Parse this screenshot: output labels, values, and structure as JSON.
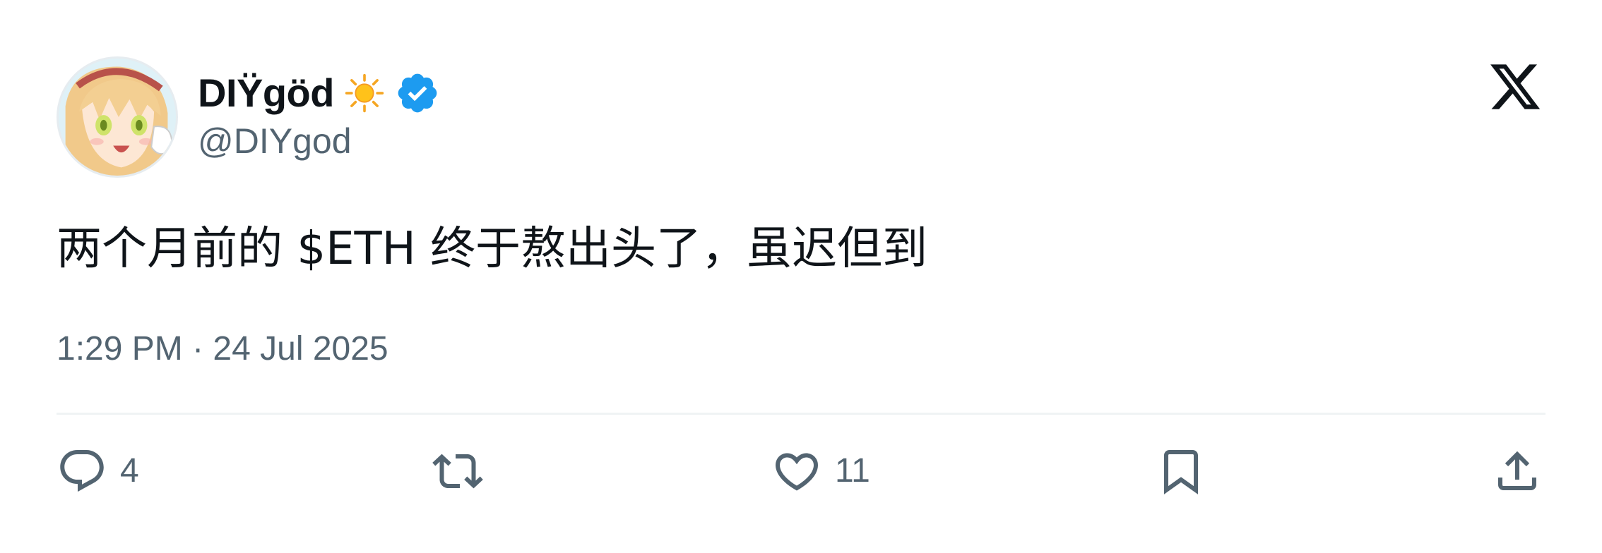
{
  "author": {
    "display_name": "DIŸgöd",
    "handle": "@DIYgod",
    "name_emoji": "sun-icon",
    "verified_icon": "verified-badge-icon",
    "verified_color": "#1d9bf0"
  },
  "tweet": {
    "text_before_cashtag": "两个月前的 ",
    "cashtag": "$ETH",
    "text_after_cashtag": " 终于熬出头了，虽迟但到",
    "timestamp": "1:29 PM · 24 Jul 2025"
  },
  "actions": {
    "reply": {
      "icon": "reply-icon",
      "count": "4"
    },
    "retweet": {
      "icon": "retweet-icon",
      "count": ""
    },
    "like": {
      "icon": "heart-icon",
      "count": "11"
    },
    "bookmark": {
      "icon": "bookmark-icon",
      "count": ""
    },
    "share": {
      "icon": "share-icon",
      "count": ""
    }
  },
  "brand": {
    "logo": "x-logo-icon"
  },
  "colors": {
    "text_primary": "#0f1419",
    "text_secondary": "#536471",
    "divider": "#eff3f4",
    "verified": "#1d9bf0"
  }
}
